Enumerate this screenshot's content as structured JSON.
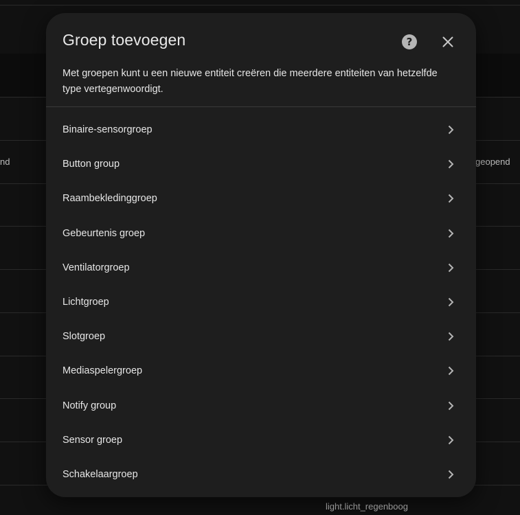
{
  "background": {
    "left_text": "nd",
    "right_text": "geopend",
    "bottom_text": "light.licht_regenboog"
  },
  "dialog": {
    "title": "Groep toevoegen",
    "description": "Met groepen kunt u een nieuwe entiteit creëren die meerdere entiteiten van hetzelfde type vertegenwoordigt.",
    "help_icon": "help-circle-icon",
    "close_icon": "close-icon",
    "items": [
      {
        "label": "Binaire-sensorgroep"
      },
      {
        "label": "Button group"
      },
      {
        "label": "Raambekledinggroep"
      },
      {
        "label": "Gebeurtenis groep"
      },
      {
        "label": "Ventilatorgroep"
      },
      {
        "label": "Lichtgroep"
      },
      {
        "label": "Slotgroep"
      },
      {
        "label": "Mediaspelergroep"
      },
      {
        "label": "Notify group"
      },
      {
        "label": "Sensor groep"
      },
      {
        "label": "Schakelaargroep"
      }
    ]
  },
  "colors": {
    "page_background": "#111111",
    "dialog_background": "#1e1e1e",
    "text_primary": "#e6e6e6",
    "icon": "#b5b5b5"
  }
}
